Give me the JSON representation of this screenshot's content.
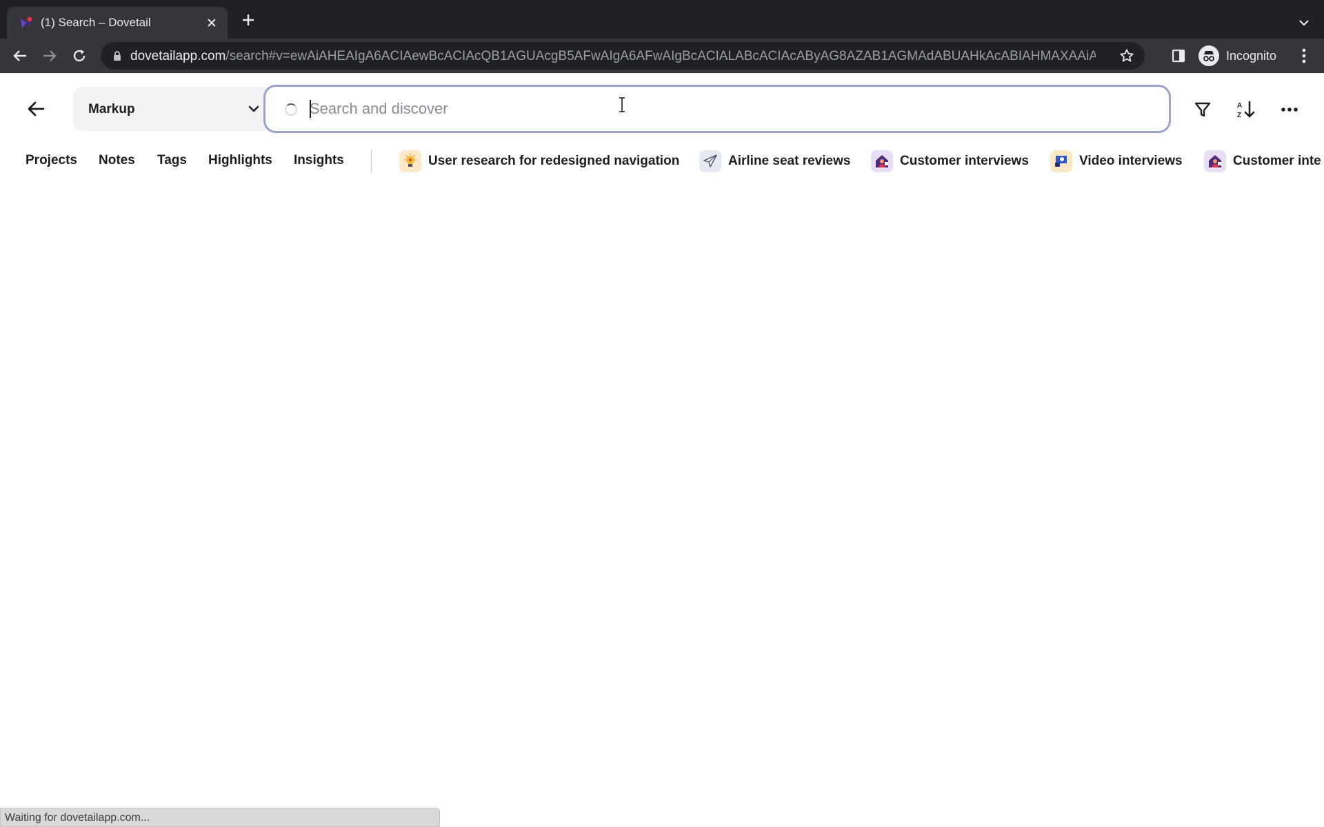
{
  "browser": {
    "tab_title": "(1) Search – Dovetail",
    "url_host": "dovetailapp.com",
    "url_path": "/search#v=ewAiAHEAIgA6ACIAewBcACIAcQB1AGUAcgB5AFwAIgA6AFwAIgBcACIALABcACIAcAByAG8AZAB1AGMAdABUAHkAcABIAHMAXAAiAD...",
    "profile_label": "Incognito",
    "status_text": "Waiting for dovetailapp.com..."
  },
  "header": {
    "workspace_label": "Markup",
    "search_placeholder": "Search and discover"
  },
  "nav": {
    "sections": [
      "Projects",
      "Notes",
      "Tags",
      "Highlights",
      "Insights"
    ],
    "projects": [
      {
        "label": "User research for redesigned navigation",
        "icon": "lightbulb-icon"
      },
      {
        "label": "Airline seat reviews",
        "icon": "airplane-icon"
      },
      {
        "label": "Customer interviews",
        "icon": "house-person-icon"
      },
      {
        "label": "Video interviews",
        "icon": "chat-person-icon"
      },
      {
        "label": "Customer inte",
        "icon": "house-person-icon"
      }
    ]
  }
}
